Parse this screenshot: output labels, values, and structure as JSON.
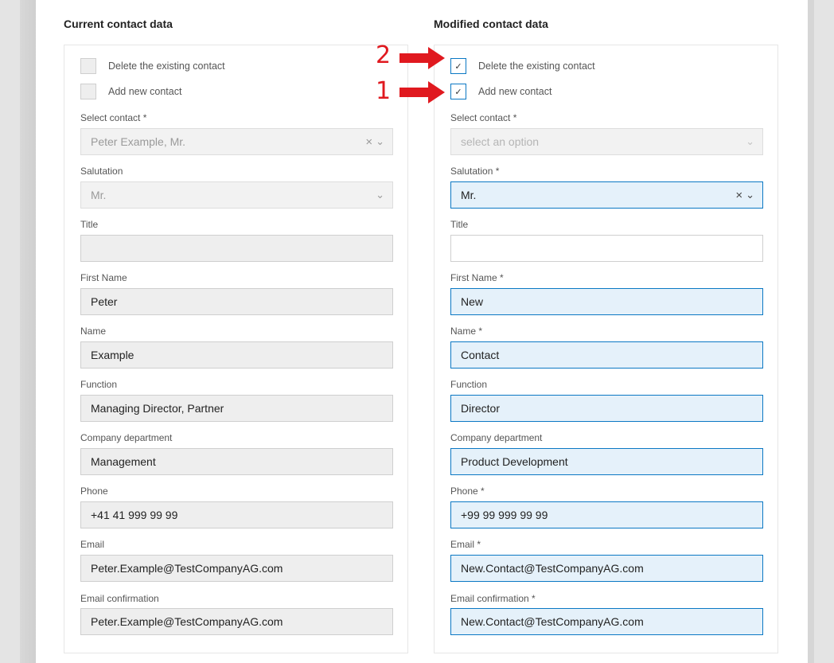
{
  "left": {
    "title": "Current contact data",
    "checkbox_delete": "Delete the existing contact",
    "checkbox_add": "Add new contact",
    "select_contact_label": "Select contact *",
    "select_contact_value": "Peter Example, Mr.",
    "salutation_label": "Salutation",
    "salutation_value": "Mr.",
    "title_label": "Title",
    "title_value": "",
    "first_name_label": "First Name",
    "first_name_value": "Peter",
    "name_label": "Name",
    "name_value": "Example",
    "function_label": "Function",
    "function_value": "Managing Director, Partner",
    "department_label": "Company department",
    "department_value": "Management",
    "phone_label": "Phone",
    "phone_value": "+41 41 999 99 99",
    "email_label": "Email",
    "email_value": "Peter.Example@TestCompanyAG.com",
    "email_confirm_label": "Email confirmation",
    "email_confirm_value": "Peter.Example@TestCompanyAG.com"
  },
  "right": {
    "title": "Modified contact data",
    "checkbox_delete": "Delete the existing contact",
    "checkbox_delete_checked": true,
    "checkbox_add": "Add new contact",
    "checkbox_add_checked": true,
    "select_contact_label": "Select contact *",
    "select_contact_placeholder": "select an option",
    "salutation_label": "Salutation *",
    "salutation_value": "Mr.",
    "title_label": "Title",
    "title_value": "",
    "first_name_label": "First Name *",
    "first_name_value": "New",
    "name_label": "Name *",
    "name_value": "Contact",
    "function_label": "Function",
    "function_value": "Director",
    "department_label": "Company department",
    "department_value": "Product Development",
    "phone_label": "Phone *",
    "phone_value": "+99 99 999 99 99",
    "email_label": "Email *",
    "email_value": "New.Contact@TestCompanyAG.com",
    "email_confirm_label": "Email confirmation *",
    "email_confirm_value": "New.Contact@TestCompanyAG.com"
  },
  "annotations": {
    "marker_delete": "2",
    "marker_add": "1"
  },
  "glyphs": {
    "check": "✓",
    "clear": "×",
    "chevron": "⌄"
  },
  "colors": {
    "accent": "#0b78c4",
    "active_field_bg": "#e5f1fa",
    "annotation_red": "#e0191f"
  }
}
